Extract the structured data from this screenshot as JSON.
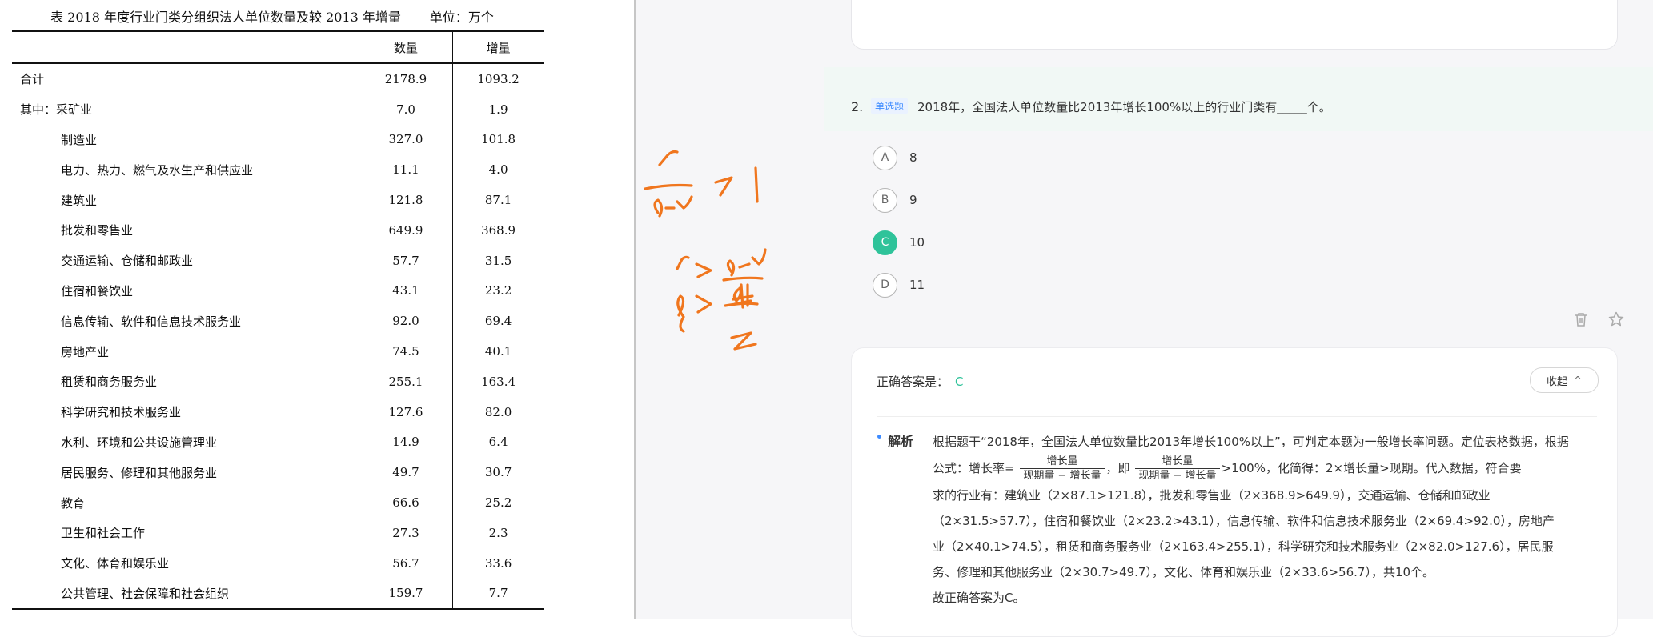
{
  "document": {
    "title": "表 2018 年度行业门类分组织法人单位数量及较 2013 年增量",
    "unit": "单位：万个",
    "columns": [
      "",
      "数量",
      "增量"
    ],
    "rows": [
      {
        "name": "合计",
        "qty": "2178.9",
        "inc": "1093.2",
        "level": 0
      },
      {
        "name": "其中：采矿业",
        "qty": "7.0",
        "inc": "1.9",
        "level": 0
      },
      {
        "name": "制造业",
        "qty": "327.0",
        "inc": "101.8",
        "level": 1
      },
      {
        "name": "电力、热力、燃气及水生产和供应业",
        "qty": "11.1",
        "inc": "4.0",
        "level": 1
      },
      {
        "name": "建筑业",
        "qty": "121.8",
        "inc": "87.1",
        "level": 1
      },
      {
        "name": "批发和零售业",
        "qty": "649.9",
        "inc": "368.9",
        "level": 1
      },
      {
        "name": "交通运输、仓储和邮政业",
        "qty": "57.7",
        "inc": "31.5",
        "level": 1
      },
      {
        "name": "住宿和餐饮业",
        "qty": "43.1",
        "inc": "23.2",
        "level": 1
      },
      {
        "name": "信息传输、软件和信息技术服务业",
        "qty": "92.0",
        "inc": "69.4",
        "level": 1
      },
      {
        "name": "房地产业",
        "qty": "74.5",
        "inc": "40.1",
        "level": 1
      },
      {
        "name": "租赁和商务服务业",
        "qty": "255.1",
        "inc": "163.4",
        "level": 1
      },
      {
        "name": "科学研究和技术服务业",
        "qty": "127.6",
        "inc": "82.0",
        "level": 1
      },
      {
        "name": "水利、环境和公共设施管理业",
        "qty": "14.9",
        "inc": "6.4",
        "level": 1
      },
      {
        "name": "居民服务、修理和其他服务业",
        "qty": "49.7",
        "inc": "30.7",
        "level": 1
      },
      {
        "name": "教育",
        "qty": "66.6",
        "inc": "25.2",
        "level": 1
      },
      {
        "name": "卫生和社会工作",
        "qty": "27.3",
        "inc": "2.3",
        "level": 1
      },
      {
        "name": "文化、体育和娱乐业",
        "qty": "56.7",
        "inc": "33.6",
        "level": 1
      },
      {
        "name": "公共管理、社会保障和社会组织",
        "qty": "159.7",
        "inc": "7.7",
        "level": 1
      }
    ]
  },
  "annotation": {
    "color": "#f0761e"
  },
  "question": {
    "number": "2.",
    "type_tag": "单选题",
    "text": "2018年，全国法人单位数量比2013年增长100%以上的行业门类有_____个。",
    "options": [
      {
        "key": "A",
        "text": "8",
        "selected": false
      },
      {
        "key": "B",
        "text": "9",
        "selected": false
      },
      {
        "key": "C",
        "text": "10",
        "selected": true
      },
      {
        "key": "D",
        "text": "11",
        "selected": false
      }
    ],
    "actions": {
      "delete_icon": "trash-icon",
      "favorite_icon": "star-icon"
    }
  },
  "answer": {
    "label": "正确答案是：",
    "value": "C",
    "collapse_label": "收起"
  },
  "explanation": {
    "label": "解析",
    "line1": "根据题干“2018年，全国法人单位数量比2013年增长100%以上”，可判定本题为一般增长率问题。定位表格数据，根据",
    "formula_prefix": "公式：增长率=",
    "frac_num": "增长量",
    "frac_den": "现期量 − 增长量",
    "formula_mid": "，即",
    "formula_suffix": ">100%，化简得：2×增长量>现期。代入数据，符合要",
    "line3": "求的行业有：建筑业（2×87.1>121.8），批发和零售业（2×368.9>649.9），交通运输、仓储和邮政业",
    "line4": "（2×31.5>57.7），住宿和餐饮业（2×23.2>43.1），信息传输、软件和信息技术服务业（2×69.4>92.0），房地产",
    "line5": "业（2×40.1>74.5），租赁和商务服务业（2×163.4>255.1），科学研究和技术服务业（2×82.0>127.6），居民服",
    "line6": "务、修理和其他服务业（2×30.7>49.7），文化、体育和娱乐业（2×33.6>56.7），共10个。",
    "conclusion": "故正确答案为C。"
  },
  "colors": {
    "accent_green": "#2fc39a",
    "accent_blue": "#3d8bff",
    "question_bg": "#f1f8f5"
  }
}
